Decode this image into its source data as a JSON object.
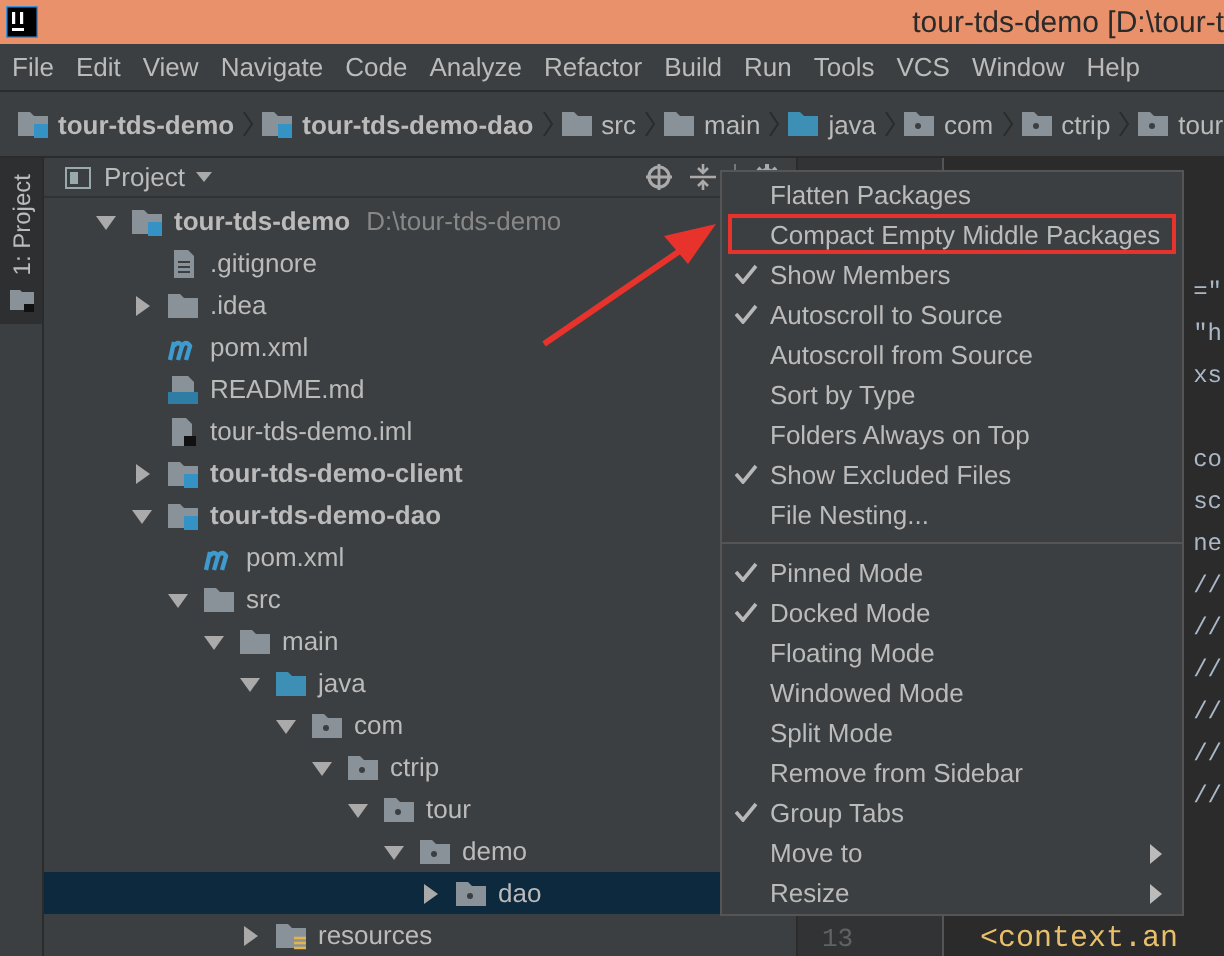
{
  "window": {
    "title": "tour-tds-demo [D:\\tour-t"
  },
  "menu_bar": [
    "File",
    "Edit",
    "View",
    "Navigate",
    "Code",
    "Analyze",
    "Refactor",
    "Build",
    "Run",
    "Tools",
    "VCS",
    "Window",
    "Help"
  ],
  "breadcrumbs": [
    {
      "label": "tour-tds-demo",
      "kind": "module"
    },
    {
      "label": "tour-tds-demo-dao",
      "kind": "module"
    },
    {
      "label": "src",
      "kind": "folder"
    },
    {
      "label": "main",
      "kind": "folder"
    },
    {
      "label": "java",
      "kind": "source"
    },
    {
      "label": "com",
      "kind": "package"
    },
    {
      "label": "ctrip",
      "kind": "package"
    },
    {
      "label": "tour",
      "kind": "package"
    }
  ],
  "side_tab": {
    "label": "1: Project",
    "selected": true
  },
  "project_panel": {
    "title": "Project",
    "tree": [
      {
        "label": "tour-tds-demo",
        "hint": "D:\\tour-tds-demo",
        "kind": "module",
        "expanded": true,
        "selected": false,
        "children": [
          {
            "label": ".gitignore",
            "kind": "file",
            "selected": false
          },
          {
            "label": ".idea",
            "kind": "folder",
            "expanded": false,
            "selected": false
          },
          {
            "label": "pom.xml",
            "kind": "maven",
            "selected": false
          },
          {
            "label": "README.md",
            "kind": "markdown",
            "selected": false
          },
          {
            "label": "tour-tds-demo.iml",
            "kind": "iml",
            "selected": false
          },
          {
            "label": "tour-tds-demo-client",
            "kind": "module",
            "expanded": false,
            "selected": false
          },
          {
            "label": "tour-tds-demo-dao",
            "kind": "module",
            "expanded": true,
            "selected": false,
            "children": [
              {
                "label": "pom.xml",
                "kind": "maven",
                "selected": false
              },
              {
                "label": "src",
                "kind": "folder",
                "expanded": true,
                "selected": false,
                "children": [
                  {
                    "label": "main",
                    "kind": "folder",
                    "expanded": true,
                    "selected": false,
                    "children": [
                      {
                        "label": "java",
                        "kind": "source",
                        "expanded": true,
                        "selected": false,
                        "children": [
                          {
                            "label": "com",
                            "kind": "package",
                            "expanded": true,
                            "selected": false,
                            "children": [
                              {
                                "label": "ctrip",
                                "kind": "package",
                                "expanded": true,
                                "selected": false,
                                "children": [
                                  {
                                    "label": "tour",
                                    "kind": "package",
                                    "expanded": true,
                                    "selected": false,
                                    "children": [
                                      {
                                        "label": "demo",
                                        "kind": "package",
                                        "expanded": true,
                                        "selected": false,
                                        "children": [
                                          {
                                            "label": "dao",
                                            "kind": "package",
                                            "expanded": false,
                                            "selected": true
                                          }
                                        ]
                                      }
                                    ]
                                  }
                                ]
                              }
                            ]
                          }
                        ]
                      },
                      {
                        "label": "resources",
                        "kind": "resources",
                        "expanded": false,
                        "selected": false
                      }
                    ]
                  }
                ]
              }
            ]
          }
        ]
      }
    ]
  },
  "editor": {
    "fragments": [
      "=\"",
      "\"h",
      "xs",
      "co",
      "sc",
      "ne",
      "//",
      "//",
      "//",
      "//",
      "//",
      "//"
    ],
    "line_number": "13",
    "last_line": "<context.an"
  },
  "context_menu": [
    {
      "label": "Flatten Packages",
      "kind": "item",
      "checked": false,
      "outlined": false
    },
    {
      "label": "Compact Empty Middle Packages",
      "kind": "item",
      "checked": false,
      "outlined": true
    },
    {
      "label": "Show Members",
      "kind": "item",
      "checked": true,
      "outlined": false
    },
    {
      "label": "Autoscroll to Source",
      "kind": "item",
      "checked": true,
      "outlined": false
    },
    {
      "label": "Autoscroll from Source",
      "kind": "item",
      "checked": false,
      "outlined": false
    },
    {
      "label": "Sort by Type",
      "kind": "item",
      "checked": false,
      "outlined": false
    },
    {
      "label": "Folders Always on Top",
      "kind": "item",
      "checked": false,
      "outlined": false
    },
    {
      "label": "Show Excluded Files",
      "kind": "item",
      "checked": true,
      "outlined": false
    },
    {
      "label": "File Nesting...",
      "kind": "item",
      "checked": false,
      "outlined": false
    },
    {
      "kind": "separator"
    },
    {
      "label": "Pinned Mode",
      "kind": "item",
      "checked": true,
      "outlined": false
    },
    {
      "label": "Docked Mode",
      "kind": "item",
      "checked": true,
      "outlined": false
    },
    {
      "label": "Floating Mode",
      "kind": "item",
      "checked": false,
      "outlined": false
    },
    {
      "label": "Windowed Mode",
      "kind": "item",
      "checked": false,
      "outlined": false
    },
    {
      "label": "Split Mode",
      "kind": "item",
      "checked": false,
      "outlined": false
    },
    {
      "label": "Remove from Sidebar",
      "kind": "item",
      "checked": false,
      "outlined": false
    },
    {
      "label": "Group Tabs",
      "kind": "item",
      "checked": true,
      "outlined": false
    },
    {
      "label": "Move to",
      "kind": "submenu",
      "checked": false,
      "outlined": false
    },
    {
      "label": "Resize",
      "kind": "submenu",
      "checked": false,
      "outlined": false
    }
  ]
}
